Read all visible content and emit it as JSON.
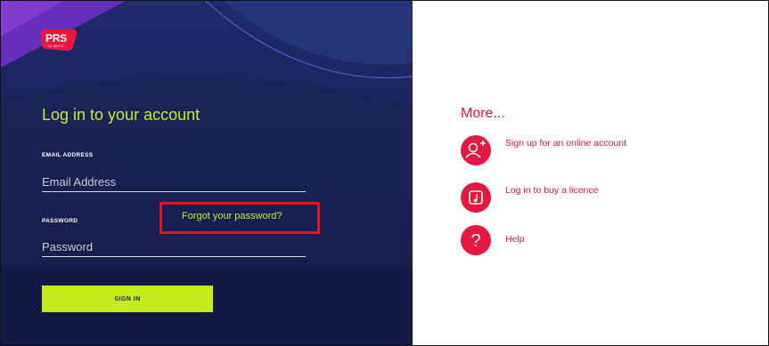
{
  "brand": {
    "logo_text": "PRS",
    "logo_sub": "for MUSIC",
    "logo_color": "#e8173f"
  },
  "login": {
    "title": "Log in to your account",
    "email_label": "EMAIL ADDRESS",
    "email_placeholder": "Email Address",
    "email_value": "",
    "password_label": "PASSWORD",
    "password_placeholder": "Password",
    "password_value": "",
    "forgot_link": "Forgot your password?",
    "signin_label": "SIGN IN",
    "accent_color": "#c6ec2c",
    "panel_color": "#1b2258"
  },
  "more": {
    "title": "More...",
    "items": [
      {
        "label": "Sign up for an online account",
        "icon": "add-user-icon"
      },
      {
        "label": "Log in to buy a licence",
        "icon": "music-note-icon"
      },
      {
        "label": "Help",
        "icon": "question-mark-icon"
      }
    ],
    "accent_color": "#e8173f"
  },
  "highlight": {
    "color": "#e0151e"
  }
}
